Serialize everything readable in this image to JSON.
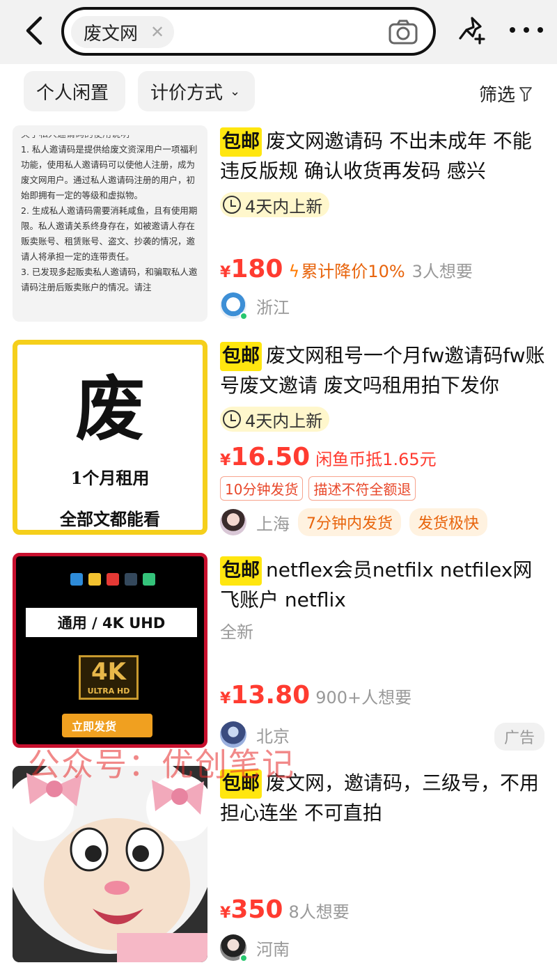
{
  "search": {
    "query": "废文网"
  },
  "filters": {
    "personal_label": "个人闲置",
    "pricing_label": "计价方式",
    "filter_label": "筛选"
  },
  "items": [
    {
      "badge": "包邮",
      "title": "废文网邀请码  不出未成年 不能违反版规  确认收货再发码 感兴",
      "new_tag": "4天内上新",
      "price_symbol": "¥",
      "price": "180",
      "extra": "累计降价10%",
      "want": "3人想要",
      "location": "浙江",
      "thumb_text": [
        "1.  私人邀请码是提供给废文资深用户一项福利功能，使用私人邀请码可以使他人注册，成为废文网用户。通过私人邀请码注册的用户，初始即拥有一定的等级和虚拟物。",
        "2.  生成私人邀请码需要消耗咸鱼，且有使用期限。私人邀请关系终身存在，如被邀请人存在贩卖账号、租赁账号、盗文、抄袭的情况，邀请人将承担一定的连带责任。",
        "3.  已发现多起贩卖私人邀请码，和骗取私人邀请码注册后贩卖账户的情况。请注"
      ]
    },
    {
      "badge": "包邮",
      "title": "废文网租号一个月fw邀请码fw账号废文邀请 废文吗租用拍下发你",
      "new_tag": "4天内上新",
      "price_symbol": "¥",
      "price": "16.50",
      "extra": "闲鱼币抵1.65元",
      "tags": [
        "10分钟发货",
        "描述不符全额退"
      ],
      "location": "上海",
      "seller_tags": [
        "7分钟内发货",
        "发货极快"
      ],
      "thumb_big": "废",
      "thumb_line1": "1个月租用",
      "thumb_line2": "全部文都能看"
    },
    {
      "badge": "包邮",
      "title": "netflex会员netfilx netfilex网飞账户 netflix",
      "condition": "全新",
      "price_symbol": "¥",
      "price": "13.80",
      "want": "900+人想要",
      "location": "北京",
      "ad": "广告",
      "thumb_bar": "通用 / 4K UHD",
      "thumb_4k": "4K",
      "thumb_ultra": "ULTRA HD",
      "thumb_btn": "立即发货"
    },
    {
      "badge": "包邮",
      "title": "废文网，邀请码，三级号，不用担心连坐 不可直拍",
      "price_symbol": "¥",
      "price": "350",
      "want": "8人想要",
      "location": "河南"
    }
  ],
  "watermark": "公众号：优创笔记",
  "colors": {
    "price": "#ff3b30",
    "badge": "#ffe60f",
    "discount": "#e8640c"
  }
}
